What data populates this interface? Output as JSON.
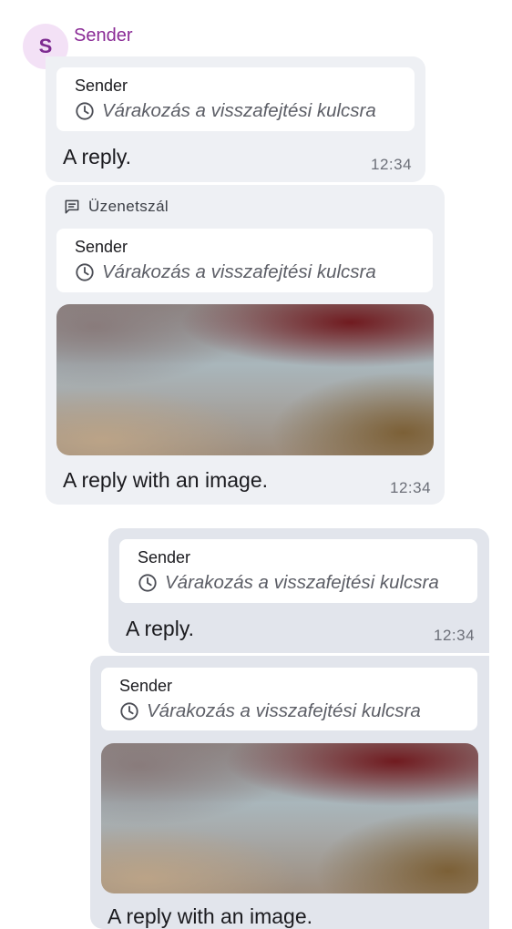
{
  "sender": {
    "initial": "S",
    "name": "Sender"
  },
  "thread_label": "Üzenetszál",
  "waiting_text": "Várakozás a visszafejtési kulcsra",
  "messages": [
    {
      "quote_sender": "Sender",
      "text": "A reply.",
      "time": "12:34"
    },
    {
      "quote_sender": "Sender",
      "text": "A reply with an image.",
      "time": "12:34"
    },
    {
      "quote_sender": "Sender",
      "text": "A reply.",
      "time": "12:34"
    },
    {
      "quote_sender": "Sender",
      "text": "A reply with an image."
    }
  ],
  "colors": {
    "accent": "#8a2b96",
    "avatar_bg": "#f3e1f6",
    "incoming_bubble": "#eef0f4",
    "outgoing_bubble": "#e2e5ec"
  },
  "icons": {
    "waiting": "clock-icon",
    "thread": "thread-icon"
  }
}
